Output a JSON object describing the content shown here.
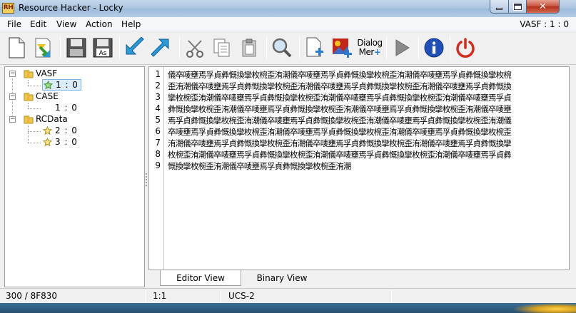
{
  "window": {
    "title": "Resource Hacker - Locky",
    "icon_text": "RH",
    "controls": [
      "minimize",
      "maximize",
      "close"
    ]
  },
  "menu": {
    "items": [
      "File",
      "Edit",
      "View",
      "Action",
      "Help"
    ],
    "resource_indicator": "VASF : 1 : 0"
  },
  "toolbar": {
    "buttons": [
      {
        "name": "new-file-icon"
      },
      {
        "name": "open-file-icon"
      },
      {
        "name": "save-icon"
      },
      {
        "name": "save-as-icon",
        "label": "As"
      },
      {
        "name": "import-arrow-icon"
      },
      {
        "name": "export-arrow-icon"
      },
      {
        "name": "cut-icon"
      },
      {
        "name": "copy-icon"
      },
      {
        "name": "paste-icon"
      },
      {
        "name": "search-icon"
      },
      {
        "name": "add-resource-icon"
      },
      {
        "name": "add-image-resource-icon"
      },
      {
        "name": "dialog-merger-icon",
        "label_top": "Dialog",
        "label_bottom": "Mer"
      },
      {
        "name": "compile-run-icon"
      },
      {
        "name": "info-icon"
      },
      {
        "name": "power-icon"
      }
    ],
    "colors": {
      "arrow_blue": "#2a9ad8",
      "info_blue": "#1f4fb8",
      "power_red": "#d62b1f",
      "play_gray": "#8a8a8a"
    }
  },
  "tree": {
    "groups": [
      {
        "label": "VASF",
        "children": [
          {
            "label": "1 : 0",
            "selected": true
          }
        ]
      },
      {
        "label": "CASE",
        "children": [
          {
            "label": "1 : 0",
            "selected": false
          }
        ]
      },
      {
        "label": "RCData",
        "children": [
          {
            "label": "2 : 0",
            "selected": false
          },
          {
            "label": "3 : 0",
            "selected": false
          }
        ]
      }
    ]
  },
  "editor": {
    "line_numbers": [
      "1",
      "2",
      "3",
      "4",
      "5",
      "6",
      "7",
      "8",
      "9"
    ],
    "lines": [
      "儀卒唛壅焉孚貞彝慨換攣枚椀歪洧潮儀卒唛壅焉孚貞彝慨換攣枚椀歪洧潮儀卒唛壅焉孚貞彝慨換攣枚椀",
      "歪洧潮儀卒唛壅焉孚貞彝慨換攣枚椀歪洧潮儀卒唛壅焉孚貞彝慨換攣枚椀歪洧潮儀卒唛壅焉孚貞彝慨換",
      "攣枚椀歪洧潮儀卒唛壅焉孚貞彝慨換攣枚椀歪洧潮儀卒唛壅焉孚貞彝慨換攣枚椀歪洧潮儀卒唛壅焉孚貞",
      "彝慨換攣枚椀歪洧潮儀卒唛壅焉孚貞彝慨換攣枚椀歪洧潮儀卒唛壅焉孚貞彝慨換攣枚椀歪洧潮儀卒唛壅",
      "焉孚貞彝慨換攣枚椀歪洧潮儀卒唛壅焉孚貞彝慨換攣枚椀歪洧潮儀卒唛壅焉孚貞彝慨換攣枚椀歪洧潮儀",
      "卒唛壅焉孚貞彝慨換攣枚椀歪洧潮儀卒唛壅焉孚貞彝慨換攣枚椀歪洧潮儀卒唛壅焉孚貞彝慨換攣枚椀歪",
      "洧潮儀卒唛壅焉孚貞彝慨換攣枚椀歪洧潮儀卒唛壅焉孚貞彝慨換攣枚椀歪洧潮儀卒唛壅焉孚貞彝慨換攣",
      "枚椀歪洧潮儀卒唛壅焉孚貞彝慨換攣枚椀歪洧潮儀卒唛壅焉孚貞彝慨換攣枚椀歪洧潮儀卒唛壅焉孚貞彝",
      "慨換攣枚椀歪洧潮儀卒唛壅焉孚貞彝慨換攣枚椀歪洧潮"
    ]
  },
  "tabs": [
    {
      "label": "Editor View",
      "active": true
    },
    {
      "label": "Binary View",
      "active": false
    }
  ],
  "status": {
    "offset": "300 / 8F830",
    "position": "1:1",
    "encoding": "UCS-2"
  }
}
